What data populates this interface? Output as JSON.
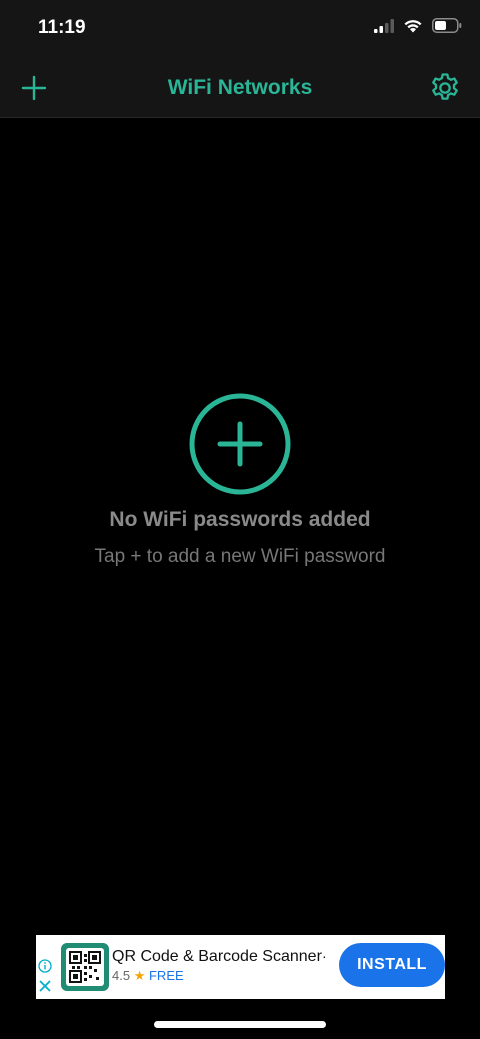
{
  "status_bar": {
    "time": "11:19"
  },
  "nav": {
    "title": "WiFi Networks",
    "add_icon": "plus-icon",
    "settings_icon": "gear-icon"
  },
  "empty_state": {
    "title": "No WiFi passwords added",
    "subtitle": "Tap + to add a new WiFi password"
  },
  "ad": {
    "app_name": "QR Code & Barcode Scanner",
    "dot": "·",
    "rating": "4.5",
    "price": "FREE",
    "install_label": "INSTALL"
  },
  "colors": {
    "accent": "#2ab597",
    "background": "#000000",
    "bar": "#151515",
    "install": "#1a73e8"
  }
}
